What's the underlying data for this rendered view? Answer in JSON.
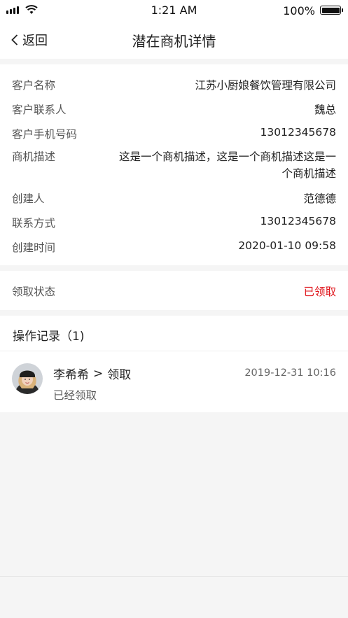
{
  "status_bar": {
    "time": "1:21 AM",
    "battery": "100%"
  },
  "nav": {
    "back_label": "返回",
    "title": "潜在商机详情"
  },
  "info": [
    {
      "label": "客户名称",
      "value": "江苏小厨娘餐饮管理有限公司"
    },
    {
      "label": "客户联系人",
      "value": "魏总"
    },
    {
      "label": "客户手机号码",
      "value": "13012345678"
    },
    {
      "label": "商机描述",
      "value": "这是一个商机描述，这是一个商机描述这是一个商机描述"
    },
    {
      "label": "创建人",
      "value": "范德德"
    },
    {
      "label": "联系方式",
      "value": "13012345678"
    },
    {
      "label": "创建时间",
      "value": "2020-01-10 09:58"
    }
  ],
  "status": {
    "label": "领取状态",
    "value": "已领取",
    "color": "#e0161c"
  },
  "records": {
    "header": "操作记录（1)",
    "items": [
      {
        "user": "李希希",
        "separator": ">",
        "action": "领取",
        "time": "2019-12-31 10:16",
        "desc": "已经领取"
      }
    ]
  }
}
